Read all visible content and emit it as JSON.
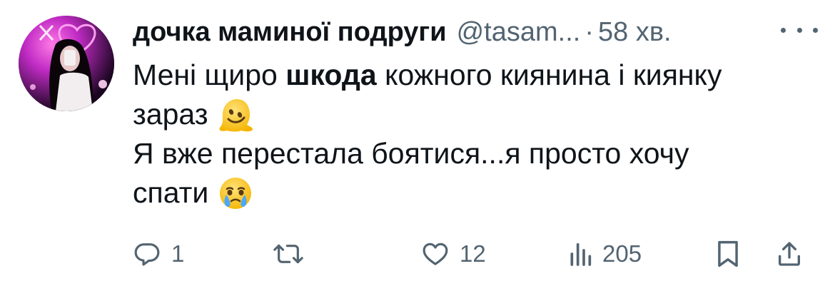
{
  "tweet": {
    "author": {
      "display_name": "дочка маминої подруги",
      "handle": "@tasam...",
      "separator": "·",
      "time": "58 хв."
    },
    "body": {
      "line1_a": "Мені щиро ",
      "line1_bold": "шкода",
      "line1_b": " кожного киянина і киянку",
      "line2": "зараз",
      "line3": "Я вже перестала боятися...я просто хочу",
      "line4": "спати"
    },
    "emojis": {
      "melting": "melting-face-emoji",
      "crying": "face-holding-back-tears-emoji"
    },
    "actions": {
      "reply_count": "1",
      "retweet_count": "",
      "like_count": "12",
      "views_count": "205"
    },
    "icons": {
      "reply": "reply-icon",
      "retweet": "retweet-icon",
      "like": "heart-icon",
      "views": "views-icon",
      "bookmark": "bookmark-icon",
      "share": "share-icon",
      "more": "more-icon"
    },
    "colors": {
      "text": "#0f1419",
      "secondary": "#536471",
      "avatar_neon": "#ff4fd8"
    }
  }
}
